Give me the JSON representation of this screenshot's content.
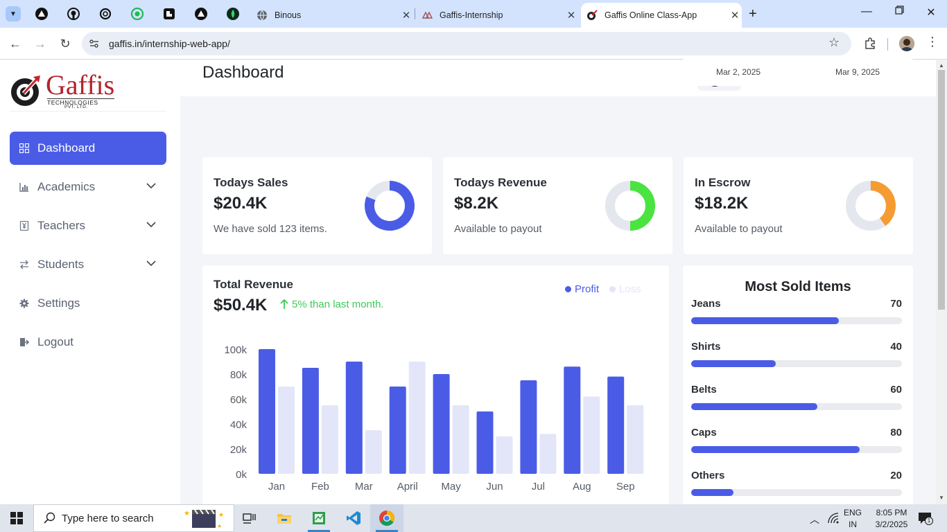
{
  "browser": {
    "tabs": [
      {
        "title": "Binous"
      },
      {
        "title": "Gaffis-Internship"
      },
      {
        "title": "Gaffis Online Class-App"
      }
    ],
    "url": "gaffis.in/internship-web-app/"
  },
  "brand": {
    "name": "Gaffis",
    "line1": "TECHNOLOGIES",
    "line2": "PVT. LTD."
  },
  "sidebar": {
    "items": [
      {
        "label": "Dashboard"
      },
      {
        "label": "Academics"
      },
      {
        "label": "Teachers"
      },
      {
        "label": "Students"
      },
      {
        "label": "Settings"
      },
      {
        "label": "Logout"
      }
    ]
  },
  "page": {
    "title": "Dashboard",
    "date_from": "Mar 2, 2025",
    "date_to": "Mar 9, 2025"
  },
  "kpis": [
    {
      "title": "Todays Sales",
      "value": "$20.4K",
      "sub": "We have sold 123 items.",
      "color": "#4a5ce6",
      "fraction": 0.81
    },
    {
      "title": "Todays Revenue",
      "value": "$8.2K",
      "sub": "Available to payout",
      "color": "#4be340",
      "fraction": 0.5
    },
    {
      "title": "In Escrow",
      "value": "$18.2K",
      "sub": "Available to payout",
      "color": "#f59b31",
      "fraction": 0.4
    }
  ],
  "revenue": {
    "title": "Total Revenue",
    "value": "$50.4K",
    "trend": "5% than last month.",
    "legend_profit": "Profit",
    "legend_loss": "Loss"
  },
  "chart_data": {
    "type": "bar",
    "categories": [
      "Jan",
      "Feb",
      "Mar",
      "April",
      "May",
      "Jun",
      "Jul",
      "Aug",
      "Sep"
    ],
    "series": [
      {
        "name": "Profit",
        "values": [
          100,
          85,
          90,
          70,
          80,
          50,
          75,
          86,
          78
        ],
        "color": "#4a5ce6"
      },
      {
        "name": "Loss",
        "values": [
          70,
          55,
          35,
          90,
          55,
          30,
          32,
          62,
          55
        ],
        "color": "#e3e6f8"
      }
    ],
    "ylim": [
      0,
      100
    ],
    "yticks": [
      "0k",
      "20k",
      "40k",
      "60k",
      "80k",
      "100k"
    ]
  },
  "most_sold": {
    "title": "Most Sold Items",
    "items": [
      {
        "name": "Jeans",
        "value": "70",
        "fraction": 0.7
      },
      {
        "name": "Shirts",
        "value": "40",
        "fraction": 0.4
      },
      {
        "name": "Belts",
        "value": "60",
        "fraction": 0.6
      },
      {
        "name": "Caps",
        "value": "80",
        "fraction": 0.8
      },
      {
        "name": "Others",
        "value": "20",
        "fraction": 0.2
      }
    ]
  },
  "taskbar": {
    "search_placeholder": "Type here to search",
    "lang": "ENG",
    "region": "IN",
    "time": "8:05 PM",
    "date": "3/2/2025",
    "notif_count": "1"
  }
}
